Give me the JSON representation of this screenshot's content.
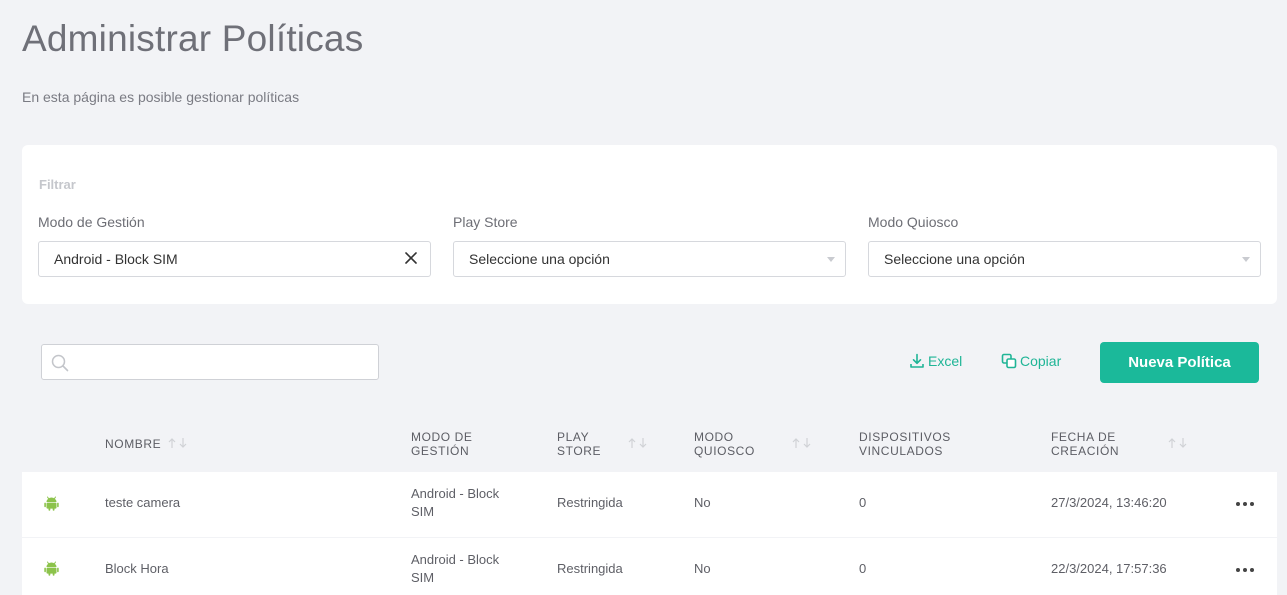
{
  "page": {
    "title": "Administrar Políticas",
    "subtitle": "En esta página es posible gestionar políticas"
  },
  "filter": {
    "heading": "Filtrar",
    "management_mode": {
      "label": "Modo de Gestión",
      "value": "Android - Block SIM"
    },
    "play_store": {
      "label": "Play Store",
      "value": "Seleccione una opción"
    },
    "kiosk_mode": {
      "label": "Modo Quiosco",
      "value": "Seleccione una opción"
    }
  },
  "toolbar": {
    "search_value": "",
    "excel_label": "Excel",
    "copy_label": "Copiar",
    "new_policy_label": "Nueva Política"
  },
  "table": {
    "headers": {
      "name": "Nombre",
      "management_mode_l1": "Modo de",
      "management_mode_l2": "Gestión",
      "play_store_l1": "Play",
      "play_store_l2": "Store",
      "kiosk_l1": "Modo",
      "kiosk_l2": "Quiosco",
      "devices_l1": "Dispositivos",
      "devices_l2": "Vinculados",
      "created_l1": "Fecha de",
      "created_l2": "Creación"
    },
    "rows": [
      {
        "icon": "android-icon",
        "name": "teste camera",
        "mode_l1": "Android - Block",
        "mode_l2": "SIM",
        "play_store": "Restringida",
        "kiosk": "No",
        "devices": "0",
        "created": "27/3/2024, 13:46:20"
      },
      {
        "icon": "android-icon",
        "name": "Block Hora",
        "mode_l1": "Android - Block",
        "mode_l2": "SIM",
        "play_store": "Restringida",
        "kiosk": "No",
        "devices": "0",
        "created": "22/3/2024, 17:57:36"
      }
    ]
  },
  "colors": {
    "accent": "#1bb99a",
    "android": "#8cc34b",
    "background": "#f2f3f6"
  }
}
